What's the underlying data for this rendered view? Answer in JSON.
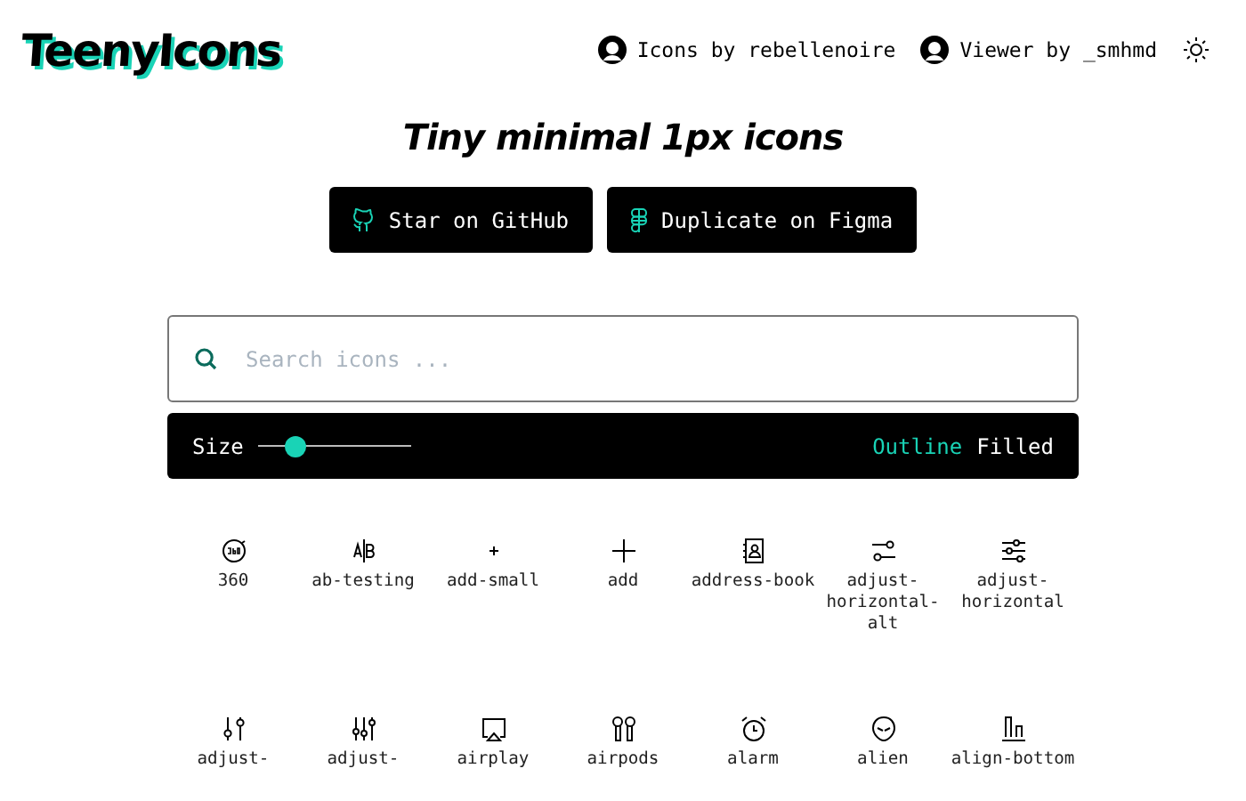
{
  "header": {
    "logo": "TeenyIcons",
    "links": [
      {
        "label": "Icons by rebellenoire"
      },
      {
        "label": "Viewer by _smhmd"
      }
    ]
  },
  "hero": {
    "title": "Tiny minimal 1px icons",
    "buttons": [
      {
        "label": "Star on GitHub"
      },
      {
        "label": "Duplicate on Figma"
      }
    ]
  },
  "search": {
    "placeholder": "Search icons ..."
  },
  "toolbar": {
    "size_label": "Size",
    "size": {
      "level": 0.24
    },
    "styles": [
      {
        "label": "Outline",
        "selected": true
      },
      {
        "label": "Filled",
        "selected": false
      }
    ]
  },
  "icons": [
    {
      "name": "360"
    },
    {
      "name": "ab-testing"
    },
    {
      "name": "add-small"
    },
    {
      "name": "add"
    },
    {
      "name": "address-book"
    },
    {
      "name": "adjust-horizontal-alt"
    },
    {
      "name": "adjust-horizontal"
    },
    {
      "name": "adjust-"
    },
    {
      "name": "adjust-"
    },
    {
      "name": "airplay"
    },
    {
      "name": "airpods"
    },
    {
      "name": "alarm"
    },
    {
      "name": "alien"
    },
    {
      "name": "align-bottom"
    }
  ]
}
